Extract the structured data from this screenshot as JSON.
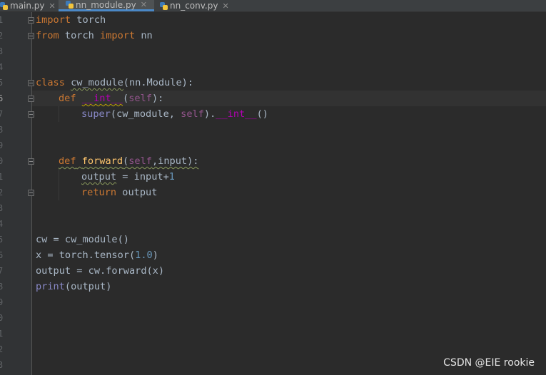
{
  "tabs": [
    {
      "label": "main.py",
      "active": false
    },
    {
      "label": "nn_module.py",
      "active": true
    },
    {
      "label": "nn_conv.py",
      "active": false
    }
  ],
  "line_numbers": [
    "1",
    "2",
    "3",
    "4",
    "5",
    "6",
    "7",
    "8",
    "9",
    "0",
    "1",
    "2",
    "3",
    "4",
    "5",
    "6",
    "7",
    "8",
    "9",
    "0",
    "1",
    "2",
    "3"
  ],
  "current_line_number": "6",
  "code": {
    "l1": {
      "kw": "import",
      "rest": " torch"
    },
    "l2": {
      "kw1": "from",
      "mid": " torch ",
      "kw2": "import",
      "rest": " nn"
    },
    "l5": {
      "kw": "class",
      "sp": " ",
      "name": "cw_module",
      "rest": "(nn.Module):"
    },
    "l6": {
      "kw": "def",
      "sp": " ",
      "magic": "__int__",
      "p1": "(",
      "self": "self",
      "p2": "):"
    },
    "l7": {
      "builtin": "super",
      "a": "(cw_module, ",
      "self": "self",
      "b": ").",
      "magic": "__int__",
      "c": "()"
    },
    "l9": {
      "kw": "def",
      "sp": " ",
      "fn": "forward",
      "p1": "(",
      "self": "self",
      "p2": ",input):"
    },
    "l10": {
      "var": "output",
      "a": " = input+",
      "num": "1"
    },
    "l11": {
      "kw": "return",
      "rest": " output"
    },
    "l14": {
      "text": "cw = cw_module()"
    },
    "l15": {
      "a": "x = torch.tensor(",
      "num": "1.0",
      "b": ")"
    },
    "l16": {
      "text": "output = cw.forward(x)"
    },
    "l17": {
      "builtin": "print",
      "rest": "(output)"
    }
  },
  "watermark": "CSDN @EIE rookie",
  "colors": {
    "background": "#2b2b2b",
    "keyword": "#cc7832",
    "function": "#ffc66d",
    "self": "#94558d",
    "magic": "#b200b2",
    "number": "#6897bb",
    "text": "#a9b7c6"
  },
  "icons": [
    "python-file-icon",
    "close-icon",
    "fold-marker-icon"
  ]
}
